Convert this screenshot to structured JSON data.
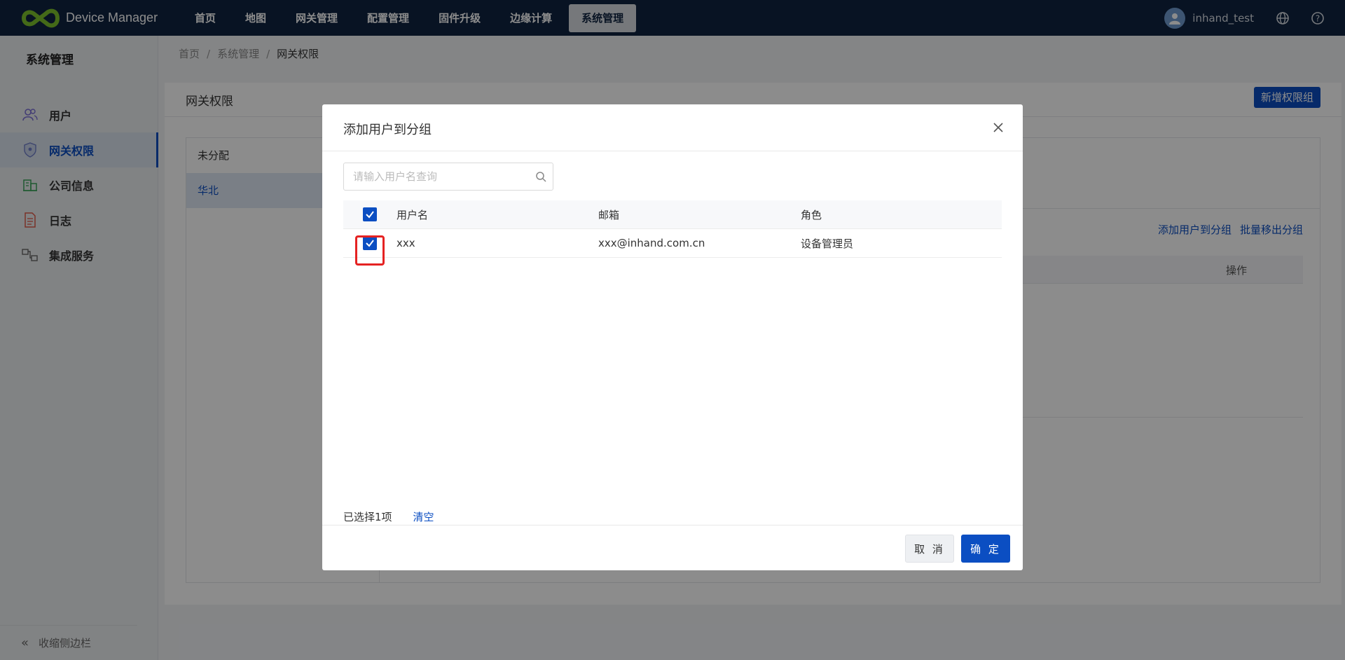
{
  "app": {
    "logo_text": "Device Manager",
    "menu": [
      "首页",
      "地图",
      "网关管理",
      "配置管理",
      "固件升级",
      "边缘计算",
      "系统管理"
    ],
    "active_menu": "系统管理",
    "username": "inhand_test"
  },
  "sidebar": {
    "title": "系统管理",
    "items": [
      {
        "label": "用户",
        "icon": "users-icon"
      },
      {
        "label": "网关权限",
        "icon": "shield-icon"
      },
      {
        "label": "公司信息",
        "icon": "company-icon"
      },
      {
        "label": "日志",
        "icon": "log-icon"
      },
      {
        "label": "集成服务",
        "icon": "integration-icon"
      }
    ],
    "active": "网关权限",
    "collapse_label": "收缩侧边栏"
  },
  "breadcrumb": [
    "首页",
    "系统管理",
    "网关权限"
  ],
  "page": {
    "title": "网关权限",
    "new_group_button": "新增权限组",
    "groups": [
      "未分配",
      "华北"
    ],
    "active_group": "华北",
    "links": [
      "添加用户到分组",
      "批量移出分组"
    ],
    "table_op_header": "操作"
  },
  "modal": {
    "title": "添加用户到分组",
    "search_placeholder": "请输入用户名查询",
    "columns": [
      "用户名",
      "邮箱",
      "角色"
    ],
    "rows": [
      {
        "username": "xxx",
        "email": "xxx@inhand.com.cn",
        "role": "设备管理员",
        "checked": true
      }
    ],
    "selected_info": "已选择1项",
    "clear_label": "清空",
    "cancel_label": "取 消",
    "ok_label": "确 定"
  },
  "colors": {
    "nav_bg": "#0f2340",
    "primary": "#0b4ec2",
    "highlight": "#e52222",
    "logo_green": "#7dc22d"
  }
}
